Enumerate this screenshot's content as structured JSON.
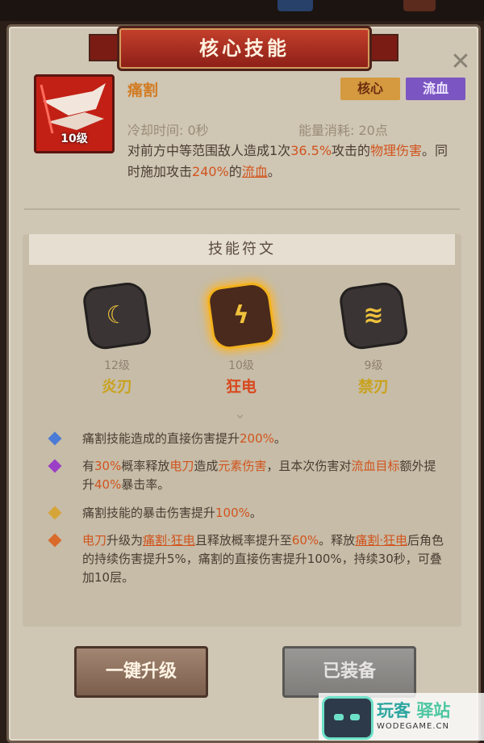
{
  "title": "核心技能",
  "close_label": "✕",
  "skill": {
    "name": "痛割",
    "level_label": "10级",
    "tags": [
      "核心",
      "流血"
    ],
    "cooldown": "冷却时间: 0秒",
    "energy": "能量消耗: 20点",
    "desc_parts": [
      "对前方中等范围敌人造成1次",
      "36.5%",
      "攻击的",
      "物理伤害",
      "。同时施加攻击",
      "240%",
      "的",
      "流血",
      "。"
    ]
  },
  "runes": {
    "header": "技能符文",
    "items": [
      {
        "level": "12级",
        "name": "炎刃",
        "glyph": "☾"
      },
      {
        "level": "10级",
        "name": "狂电",
        "glyph": "ϟ"
      },
      {
        "level": "9级",
        "name": "禁刃",
        "glyph": "≋"
      }
    ]
  },
  "effects": [
    {
      "color": "#4b7bd6",
      "parts": [
        "痛割技能造成的直接伤害提升",
        "200%",
        "。"
      ]
    },
    {
      "color": "#9c3fc7",
      "parts": [
        "有",
        "30%",
        "概率释放",
        "电刀",
        "造成",
        "元素伤害",
        "，且本次伤害对",
        "流血目标",
        "额外提升",
        "40%",
        "暴击率。"
      ]
    },
    {
      "color": "#d6a53a",
      "parts": [
        "痛割技能的暴击伤害提升",
        "100%",
        "。"
      ]
    },
    {
      "color": "#d96a2a",
      "parts": [
        "电刀",
        "升级为",
        "痛割·狂电",
        "且释放概率提升至",
        "60%",
        "。释放",
        "痛割·狂电",
        "后角色的持续伤害提升5%，痛割的直接伤害提升100%，持续30秒，可叠加10层。"
      ]
    }
  ],
  "buttons": {
    "upgrade": "一键升级",
    "equipped": "已装备"
  },
  "watermark": {
    "brand_a": "玩客",
    "brand_b": "驿站",
    "domain": "WODEGAME.CN"
  },
  "colors": {
    "accent": "#d2541e",
    "tag_core": "#d59a3f",
    "tag_bleed": "#7b56c2"
  }
}
